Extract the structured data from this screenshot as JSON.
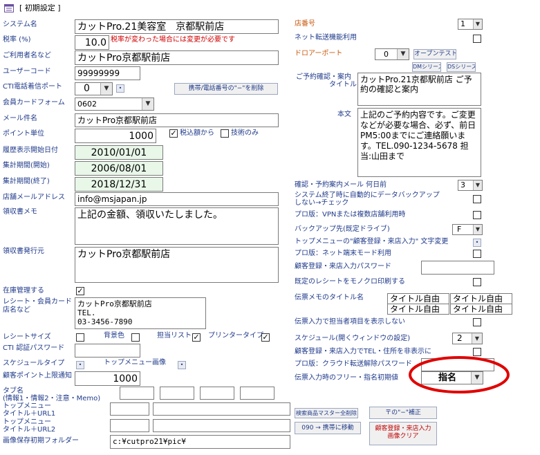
{
  "window": {
    "title": "[ 初期設定 ]"
  },
  "left": {
    "system_name": {
      "label": "システム名",
      "value": "カットPro.21美容室　京都駅前店"
    },
    "tax": {
      "label": "税率 (%)",
      "value": "10.0",
      "note": "税率が変わった場合には変更が必要です"
    },
    "user_name": {
      "label": "ご利用者名など",
      "value": "カットPro京都駅前店"
    },
    "user_code": {
      "label": "ユーザーコード",
      "value": "99999999"
    },
    "cti_port": {
      "label": "CTI電話着信ポート",
      "value": "0",
      "delete_button": "携帯/電話番号の\"−\"を削除"
    },
    "member_card": {
      "label": "会員カードフォーム",
      "value": "0602"
    },
    "mail_subject": {
      "label": "メール件名",
      "value": "カットPro京都駅前店"
    },
    "point_unit": {
      "label": "ポイント単位",
      "value": "1000",
      "tax_included_label": "税込額から",
      "tax_included_checked": true,
      "tech_only_label": "技術のみ",
      "tech_only_checked": false
    },
    "history_start": {
      "label": "履歴表示開始日付",
      "value": "2010/01/01"
    },
    "period_start": {
      "label": "集計期間(開始)",
      "value": "2006/08/01"
    },
    "period_end": {
      "label": "集計期間(終了)",
      "value": "2018/12/31"
    },
    "store_mail": {
      "label": "店舗メールアドレス",
      "value": "info@msjapan.jp"
    },
    "receipt_memo": {
      "label": "領収書メモ",
      "value": "上記の金額、領収いたしました。"
    },
    "receipt_issuer": {
      "label": "領収書発行元",
      "value": "カットPro京都駅前店"
    },
    "inventory": {
      "label": "在庫管理する",
      "checked": true
    },
    "receipt_store": {
      "label_line1": "レシート・会員カード",
      "label_line2": "店名など",
      "value": "カットPro京都駅前店\nTEL.\n03-3456-7890"
    },
    "receipt_size": {
      "label": "レシートサイズ",
      "checked": false,
      "bg_label": "背景色",
      "bg_checked": false,
      "staff_list_label": "担当リスト",
      "staff_list_checked": true,
      "printer_label": "プリンタータイプ",
      "printer_checked": true
    },
    "cti_password": {
      "label": "CTI 認証パスワード",
      "value": ""
    },
    "schedule_type": {
      "label": "スケジュールタイプ",
      "top_menu_image_label": "トップメニュー画像"
    },
    "point_limit": {
      "label": "顧客ポイント上限通知",
      "value": "1000"
    },
    "tab_name": {
      "label_line1": "タブ名",
      "label_line2": "(情報1・情報2・注意・Memo)"
    },
    "top_menu1": {
      "label_line1": "トップメニュー",
      "label_line2": "タイトル＋URL1"
    },
    "top_menu2": {
      "label_line1": "トップメニュー",
      "label_line2": "タイトル＋URL2"
    },
    "image_folder": {
      "label": "画像保存初期フォルダー",
      "value": "c:¥cutpro21¥pic¥"
    }
  },
  "right": {
    "store_number": {
      "label": "店番号",
      "value": "1"
    },
    "net_transfer": {
      "label": "ネット転送機能利用",
      "checked": false
    },
    "drawer_port": {
      "label": "ドロアーポート",
      "value": "0",
      "open_test": "オープンテスト"
    },
    "dm_series": "DMシリーズ",
    "ds_series": "DSシリーズ",
    "reservation_title": {
      "label_line1": "ご予約確認・案内",
      "label_line2": "タイトル",
      "value": "カットPro.21京都駅前店 ご予約の確認と案内"
    },
    "body_text": {
      "label": "本文",
      "value": "上記のご予約内容です。ご変更などが必要な場合、必ず、前日PM5:00までにご連絡願います。TEL.090-1234-5678 担当:山田まで"
    },
    "confirm_mail": {
      "label": "確認・予約案内メール 何日前",
      "value": "3"
    },
    "auto_backup": {
      "label_line1": "システム終了時に自動的にデータバックアップ",
      "label_line2": "しない→チェック",
      "checked": false
    },
    "pro_vpn": {
      "label": "プロ版：VPNまたは複数店舗利用時",
      "checked": false
    },
    "backup_drive": {
      "label": "バックアップ先(既定ドライブ)",
      "value": "F"
    },
    "top_menu_text": {
      "label": "トップメニューの\"顧客登録・来店入力\" 文字変更"
    },
    "pro_net": {
      "label": "プロ版：ネット端末モード利用",
      "checked": false
    },
    "customer_password": {
      "label": "顧客登録・来店入力パスワード",
      "value": ""
    },
    "mono_print": {
      "label": "既定のレシートをモノクロ印刷する",
      "checked": false
    },
    "slip_memo": {
      "label": "伝票メモのタイトル名",
      "titles": [
        "タイトル自由",
        "タイトル自由",
        "タイトル自由",
        "タイトル自由"
      ]
    },
    "hide_staff": {
      "label": "伝票入力で担当者項目を表示しない",
      "checked": false
    },
    "schedule": {
      "label": "スケジュール(開くウィンドウの設定)",
      "value": "2"
    },
    "show_tel": {
      "label": "顧客登録・来店入力でTEL・住所を非表示に",
      "checked": false
    },
    "cloud_password": {
      "label": "プロ版：クラウド転送解除パスワード",
      "value": ""
    },
    "free_designation": {
      "label": "伝票入力時のフリー・指名初期値",
      "value": "指名"
    }
  },
  "buttons": {
    "delete_master": "検索商品マスター全削除",
    "fix_hyphen": "〒の\"−\"補正",
    "move_090": "090 → 携帯に移動",
    "clear_images_line1": "顧客登録・来店入力",
    "clear_images_line2": "画像クリア"
  },
  "colors": {
    "label": "#1f3a8a",
    "label_alt": "#c85a10",
    "note": "#d00000",
    "date_field": "#e8f7e8",
    "highlight_ellipse": "#e00000"
  }
}
